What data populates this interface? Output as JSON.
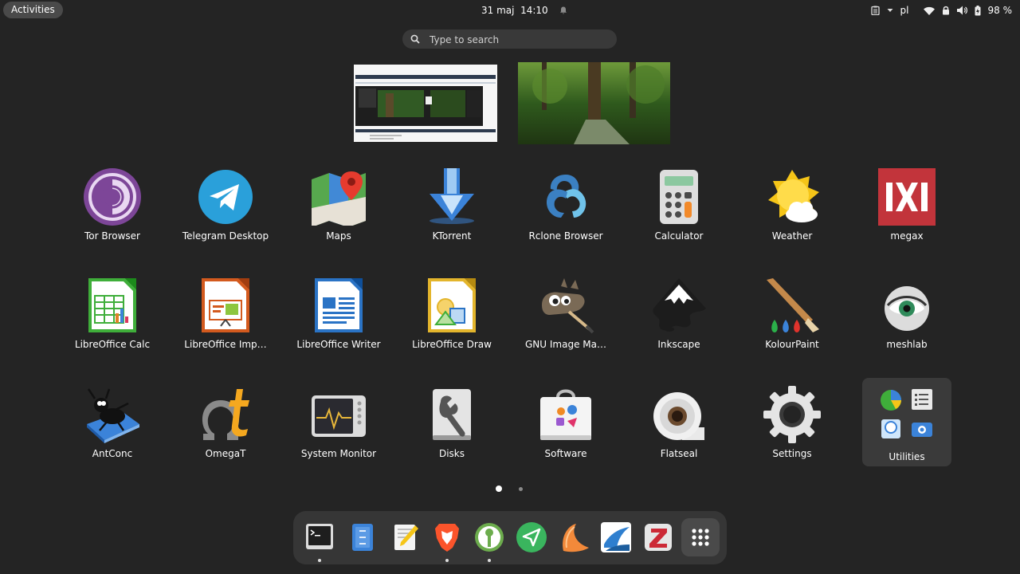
{
  "topbar": {
    "activities_label": "Activities",
    "date": "31 maj",
    "time": "14:10",
    "keyboard_layout": "pl",
    "battery_percent": "98 %"
  },
  "search": {
    "placeholder": "Type to search"
  },
  "apps": [
    {
      "label": "Tor Browser",
      "icon": "tor-browser-icon"
    },
    {
      "label": "Telegram Desktop",
      "icon": "telegram-icon"
    },
    {
      "label": "Maps",
      "icon": "maps-icon"
    },
    {
      "label": "KTorrent",
      "icon": "ktorrent-icon"
    },
    {
      "label": "Rclone Browser",
      "icon": "rclone-icon"
    },
    {
      "label": "Calculator",
      "icon": "calculator-icon"
    },
    {
      "label": "Weather",
      "icon": "weather-icon"
    },
    {
      "label": "megax",
      "icon": "megax-icon"
    },
    {
      "label": "LibreOffice Calc",
      "icon": "libreoffice-calc-icon"
    },
    {
      "label": "LibreOffice Imp…",
      "icon": "libreoffice-impress-icon"
    },
    {
      "label": "LibreOffice Writer",
      "icon": "libreoffice-writer-icon"
    },
    {
      "label": "LibreOffice Draw",
      "icon": "libreoffice-draw-icon"
    },
    {
      "label": "GNU Image Ma…",
      "icon": "gimp-icon"
    },
    {
      "label": "Inkscape",
      "icon": "inkscape-icon"
    },
    {
      "label": "KolourPaint",
      "icon": "kolourpaint-icon"
    },
    {
      "label": "meshlab",
      "icon": "meshlab-icon"
    },
    {
      "label": "AntConc",
      "icon": "antconc-icon"
    },
    {
      "label": "OmegaT",
      "icon": "omegat-icon"
    },
    {
      "label": "System Monitor",
      "icon": "system-monitor-icon"
    },
    {
      "label": "Disks",
      "icon": "disks-icon"
    },
    {
      "label": "Software",
      "icon": "software-icon"
    },
    {
      "label": "Flatseal",
      "icon": "flatseal-icon"
    },
    {
      "label": "Settings",
      "icon": "settings-icon"
    },
    {
      "label": "Utilities",
      "icon": "utilities-folder-icon"
    }
  ],
  "pages": {
    "count": 2,
    "current": 1
  },
  "dock": [
    {
      "name": "terminal-icon",
      "running": true
    },
    {
      "name": "files-icon",
      "running": false
    },
    {
      "name": "text-editor-icon",
      "running": false
    },
    {
      "name": "brave-browser-icon",
      "running": true
    },
    {
      "name": "keepassxc-icon",
      "running": true
    },
    {
      "name": "send-app-icon",
      "running": false
    },
    {
      "name": "clementine-icon",
      "running": false
    },
    {
      "name": "stellarium-icon",
      "running": false
    },
    {
      "name": "zotero-icon",
      "running": false
    },
    {
      "name": "show-apps-icon",
      "running": false
    }
  ],
  "colors": {
    "background": "#242424",
    "accent_tor": "#7d4698",
    "accent_telegram": "#2aa0da"
  }
}
